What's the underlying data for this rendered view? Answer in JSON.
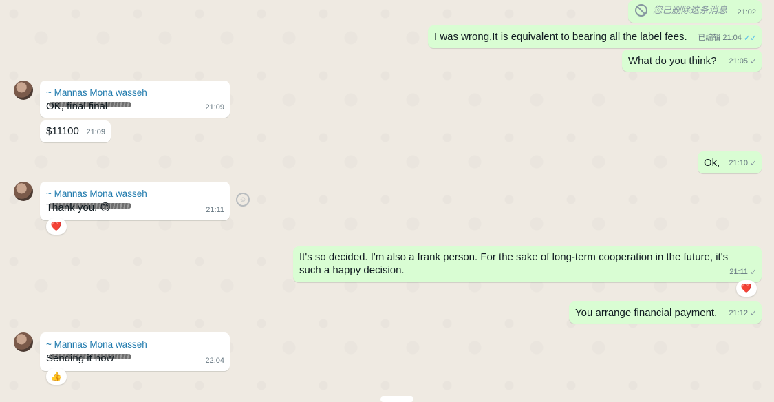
{
  "messages": {
    "deleted": {
      "text": "您已删除这条消息",
      "time": "21:02"
    },
    "out1": {
      "text": "I was wrong,It is equivalent to bearing all the label fees.",
      "edited": "已编辑",
      "time": "21:04",
      "status": "double-check-read"
    },
    "out2": {
      "text": "What do you think?",
      "time": "21:05",
      "status": "check"
    },
    "in1": {
      "sender": "~ Mannas Mona wasseh",
      "text": "OK, final final",
      "time": "21:09"
    },
    "in2": {
      "text": "$11100",
      "time": "21:09"
    },
    "out3": {
      "text": "Ok,",
      "time": "21:10",
      "status": "check"
    },
    "in3": {
      "sender": "~ Mannas Mona wasseh",
      "text": "Thank you. 😊",
      "time": "21:11",
      "reaction": "❤️"
    },
    "out4": {
      "text": "It's so decided. I'm also a frank person. For the sake of long-term cooperation in the future, it's such a happy decision.",
      "time": "21:11",
      "status": "check",
      "reaction": "❤️"
    },
    "out5": {
      "text": "You arrange financial payment.",
      "time": "21:12",
      "status": "check"
    },
    "in4": {
      "sender": "~ Mannas Mona wasseh",
      "text": "Sending it now",
      "time": "22:04",
      "reaction": "👍"
    }
  },
  "icons": {
    "single_check": "✓",
    "double_check": "✓✓",
    "emoji_button": "☺"
  },
  "colors": {
    "outgoing": "#d9fdd3",
    "incoming": "#ffffff",
    "sender_name": "#1f7aad",
    "read_tick": "#53bdeb",
    "background": "#efeae2"
  }
}
